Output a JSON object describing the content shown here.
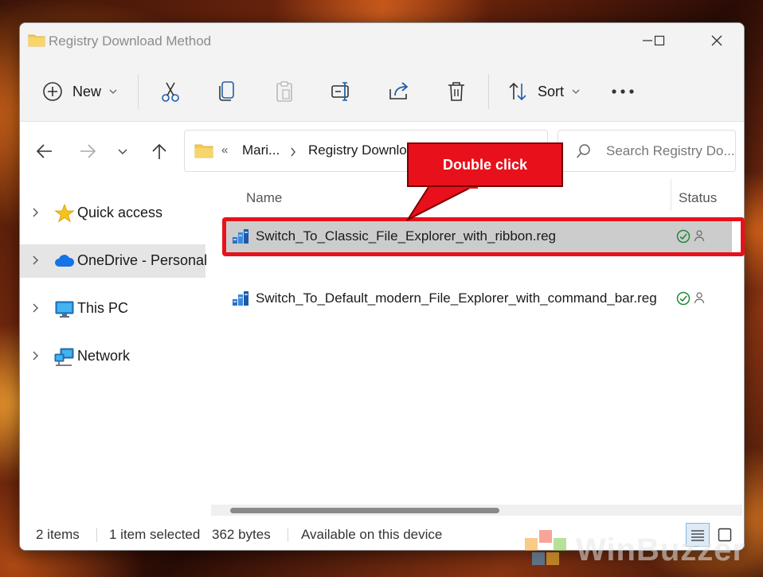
{
  "window": {
    "title": "Registry Download Method"
  },
  "toolbar": {
    "new_label": "New",
    "sort_label": "Sort"
  },
  "address": {
    "overflow": "«",
    "crumbs": [
      "Mari...",
      "Registry Downlo"
    ]
  },
  "search": {
    "placeholder": "Search Registry Do..."
  },
  "sidebar": {
    "items": [
      {
        "label": "Quick access"
      },
      {
        "label": "OneDrive - Personal"
      },
      {
        "label": "This PC"
      },
      {
        "label": "Network"
      }
    ]
  },
  "columns": {
    "name": "Name",
    "status": "Status"
  },
  "files": [
    {
      "name": "Switch_To_Classic_File_Explorer_with_ribbon.reg",
      "selected": true
    },
    {
      "name": "Switch_To_Default_modern_File_Explorer_with_command_bar.reg",
      "selected": false
    }
  ],
  "status": {
    "items": "2 items",
    "selected": "1 item selected",
    "size": "362 bytes",
    "availability": "Available on this device"
  },
  "annotation": {
    "callout": "Double click",
    "color": "#e8111b"
  },
  "watermark": {
    "text": "WinBuzzer"
  },
  "colors": {
    "folder": "#f4c94e",
    "selection": "#cccccc",
    "onedrive": "#1473e6",
    "status_ok": "#1f8a3b"
  }
}
